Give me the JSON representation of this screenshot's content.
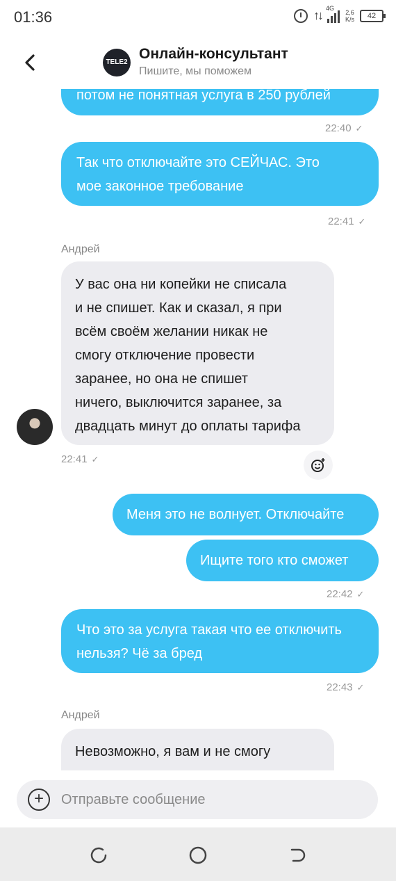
{
  "status_bar": {
    "time": "01:36",
    "network": "4G",
    "speed_top": "2,6",
    "speed_bottom": "K/s",
    "battery": "42"
  },
  "header": {
    "logo_text": "TELE2",
    "title": "Онлайн-консультант",
    "subtitle": "Пишите, мы поможем"
  },
  "messages": [
    {
      "direction": "out",
      "lines": [
        "потом не понятная услуга в 250 рублей"
      ],
      "time": "22:40",
      "status_icon": "check-icon"
    },
    {
      "direction": "out",
      "lines": [
        "Так что отключайте это  СЕЙЧАС. Это",
        "мое законное требование"
      ],
      "time": "22:41",
      "status_icon": "check-icon"
    },
    {
      "direction": "in",
      "sender": "Андрей",
      "lines": [
        "У вас она ни копейки не списала",
        "и не спишет. Как и сказал, я при",
        "всём своём желании никак не",
        "смогу отключение провести",
        "заранее, но она не спишет",
        "ничего, выключится заранее, за",
        "двадцать минут до оплаты тарифа"
      ],
      "time": "22:41",
      "status_icon": "check-icon"
    },
    {
      "direction": "out",
      "lines": [
        "Меня это не волнует. Отключайте"
      ]
    },
    {
      "direction": "out",
      "lines": [
        "Ищите того кто сможет"
      ],
      "time": "22:42",
      "status_icon": "check-icon"
    },
    {
      "direction": "out",
      "lines": [
        "Что это за услуга такая что ее отключить",
        "нельзя? Чё за бред"
      ],
      "time": "22:43",
      "status_icon": "check-icon"
    },
    {
      "direction": "in",
      "sender": "Андрей",
      "lines": [
        "Невозможно, я вам и не смогу"
      ]
    }
  ],
  "input": {
    "placeholder": "Отправьте сообщение"
  },
  "colors": {
    "outgoing_bubble": "#3dc1f3",
    "incoming_bubble": "#ececf0",
    "nav_bar": "#ececec"
  },
  "icons": {
    "back": "back-arrow-icon",
    "reaction": "emoji-add-icon",
    "attach": "plus-circle-icon",
    "nav_recent": "recent-apps-icon",
    "nav_home": "home-icon",
    "nav_back": "back-nav-icon"
  }
}
